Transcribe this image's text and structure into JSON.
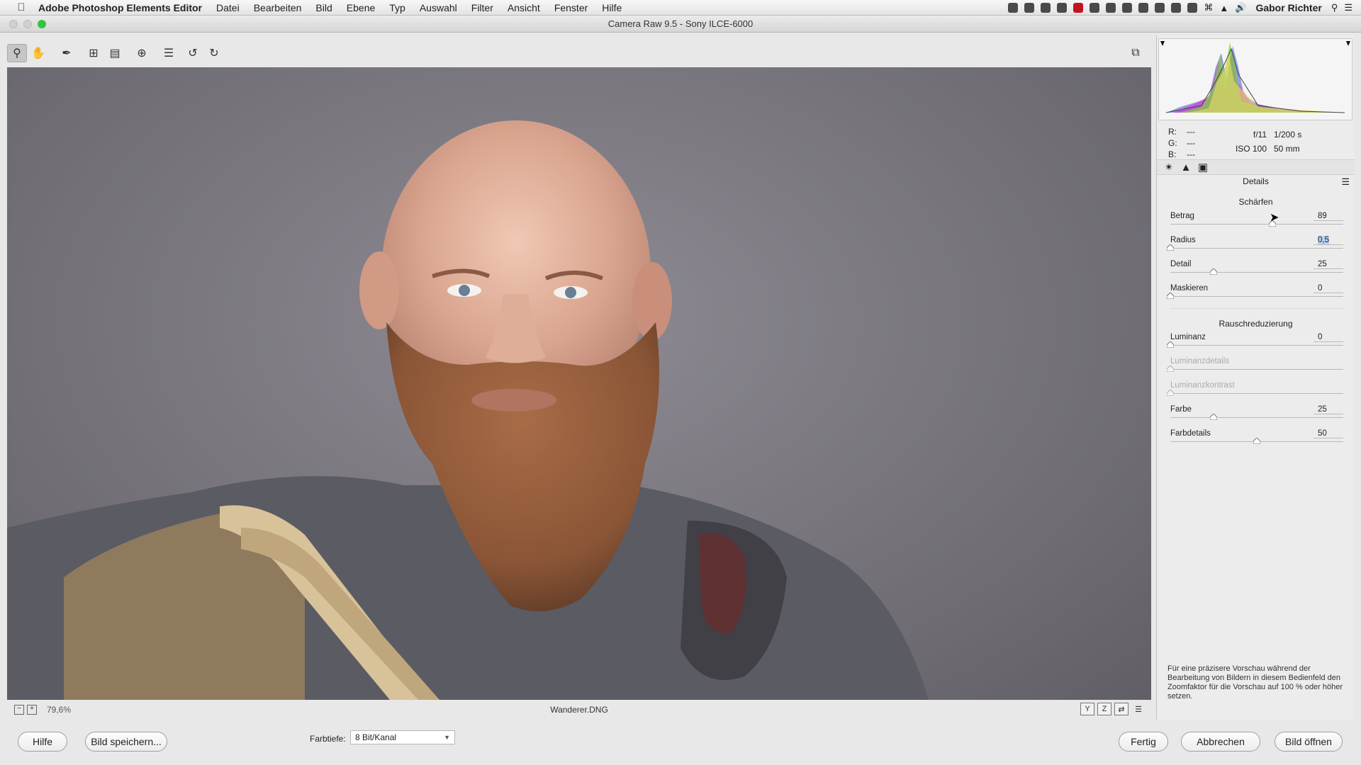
{
  "menubar": {
    "app_name": "Adobe Photoshop Elements Editor",
    "items": [
      "Datei",
      "Bearbeiten",
      "Bild",
      "Ebene",
      "Typ",
      "Auswahl",
      "Filter",
      "Ansicht",
      "Fenster",
      "Hilfe"
    ],
    "user": "Gabor Richter"
  },
  "window": {
    "title": "Camera Raw 9.5 - Sony ILCE-6000"
  },
  "toolbar": {
    "tools": [
      "zoom-icon",
      "hand-icon",
      "eyedropper-icon",
      "crop-icon",
      "straighten-icon",
      "redeye-icon",
      "list-icon",
      "rotate-left-icon",
      "rotate-right-icon"
    ],
    "active_tool": "zoom-icon"
  },
  "image_status": {
    "zoom": "79,6%",
    "filename": "Wanderer.DNG"
  },
  "histogram_info": {
    "r_label": "R:",
    "r_value": "---",
    "g_label": "G:",
    "g_value": "---",
    "b_label": "B:",
    "b_value": "---",
    "aperture": "f/11",
    "shutter": "1/200 s",
    "iso": "ISO 100",
    "focal": "50 mm"
  },
  "panel": {
    "title": "Details",
    "sharpen_header": "Schärfen",
    "noise_header": "Rauschreduzierung",
    "sharpen": [
      {
        "label": "Betrag",
        "value": "89",
        "fraction": 0.59,
        "selected": false
      },
      {
        "label": "Radius",
        "value": "0,5",
        "fraction": 0.0,
        "selected": true
      },
      {
        "label": "Detail",
        "value": "25",
        "fraction": 0.25,
        "selected": false
      },
      {
        "label": "Maskieren",
        "value": "0",
        "fraction": 0.0,
        "selected": false
      }
    ],
    "noise": [
      {
        "label": "Luminanz",
        "value": "0",
        "fraction": 0.0,
        "disabled": false
      },
      {
        "label": "Luminanzdetails",
        "value": "",
        "fraction": 0.0,
        "disabled": true
      },
      {
        "label": "Luminanzkontrast",
        "value": "",
        "fraction": 0.0,
        "disabled": true
      },
      {
        "label": "Farbe",
        "value": "25",
        "fraction": 0.25,
        "disabled": false
      },
      {
        "label": "Farbdetails",
        "value": "50",
        "fraction": 0.5,
        "disabled": false
      }
    ],
    "tip": "Für eine präzisere Vorschau während der Bearbeitung von Bildern in diesem Bedienfeld den Zoomfaktor für die Vorschau auf 100 % oder höher setzen."
  },
  "footer": {
    "help": "Hilfe",
    "save_image": "Bild speichern...",
    "depth_label": "Farbtiefe:",
    "depth_value": "8 Bit/Kanal",
    "done": "Fertig",
    "cancel": "Abbrechen",
    "open_image": "Bild öffnen"
  }
}
